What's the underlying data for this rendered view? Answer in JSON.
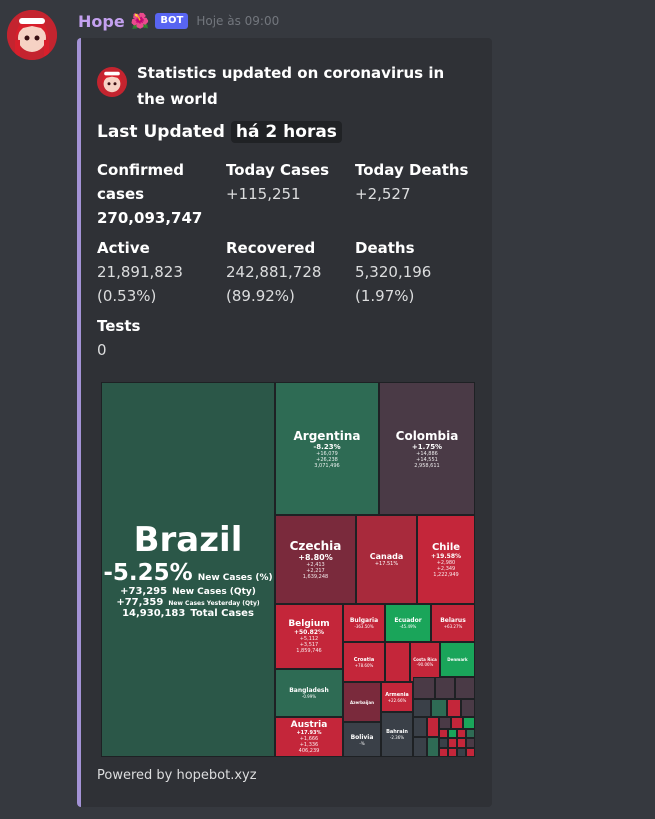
{
  "message": {
    "username": "Hope",
    "bot_tag": "BOT",
    "timestamp": "Hoje às 09:00"
  },
  "embed": {
    "author": "Statistics updated on coronavirus in the world",
    "title_prefix": "Last Updated",
    "title_code": "há 2 horas",
    "fields": [
      {
        "name": "Confirmed cases",
        "value": "270,093,747"
      },
      {
        "name": "Today Cases",
        "value": "+115,251"
      },
      {
        "name": "Today Deaths",
        "value": "+2,527"
      },
      {
        "name": "Active",
        "value": "21,891,823 (0.53%)"
      },
      {
        "name": "Recovered",
        "value": "242,881,728 (89.92%)"
      },
      {
        "name": "Deaths",
        "value": "5,320,196 (1.97%)"
      },
      {
        "name": "Tests",
        "value": "0"
      }
    ],
    "footer": "Powered by hopebot.xyz"
  },
  "treemap": {
    "brazil": {
      "name": "Brazil",
      "pct": "-5.25%",
      "pct_label": "New Cases (%)",
      "new_qty": "+73,295",
      "new_qty_label": "New Cases (Qty)",
      "yesterday": "+77,359",
      "yesterday_label": "New Cases Yesterday (Qty)",
      "total": "14,930,183",
      "total_label": "Total Cases"
    },
    "tiles": [
      {
        "name": "Argentina",
        "pct": "-8.23%",
        "l1": "+16,079",
        "l2": "+26,238",
        "l3": "3,071,496"
      },
      {
        "name": "Colombia",
        "pct": "+1.75%",
        "l1": "+14,886",
        "l2": "+14,551",
        "l3": "2,958,611"
      },
      {
        "name": "Czechia",
        "pct": "+8.80%",
        "l1": "+2,413",
        "l2": "+2,217",
        "l3": "1,639,248"
      },
      {
        "name": "Canada",
        "pct": "+17.51%"
      },
      {
        "name": "Chile",
        "pct": "+19.58%",
        "l1": "+2,980",
        "l2": "+2,349",
        "l3": "1,222,949"
      },
      {
        "name": "Belgium",
        "pct": "+50.82%",
        "l1": "+5,112",
        "l2": "+3,517",
        "l3": "1,859,746"
      },
      {
        "name": "Bulgaria",
        "pct": "-363.50%"
      },
      {
        "name": "Ecuador",
        "pct": "-45.49%"
      },
      {
        "name": "Belarus",
        "pct": "+63.27%"
      },
      {
        "name": "Croatia",
        "pct": "+78.60%"
      },
      {
        "name": "Costa Rica",
        "pct": "-90.06%"
      },
      {
        "name": "Denmark",
        "pct": ""
      },
      {
        "name": "Bangladesh",
        "pct": "-0.99%"
      },
      {
        "name": "Azerbaijan",
        "pct": ""
      },
      {
        "name": "Armenia",
        "pct": "+22.66%"
      },
      {
        "name": "Austria",
        "pct": "+17.93%",
        "l1": "+1,666",
        "l2": "+1,336",
        "l3": "406,239"
      },
      {
        "name": "Bolivia",
        "pct": "-%"
      },
      {
        "name": "Bahrain",
        "pct": "-2.36%"
      }
    ]
  }
}
